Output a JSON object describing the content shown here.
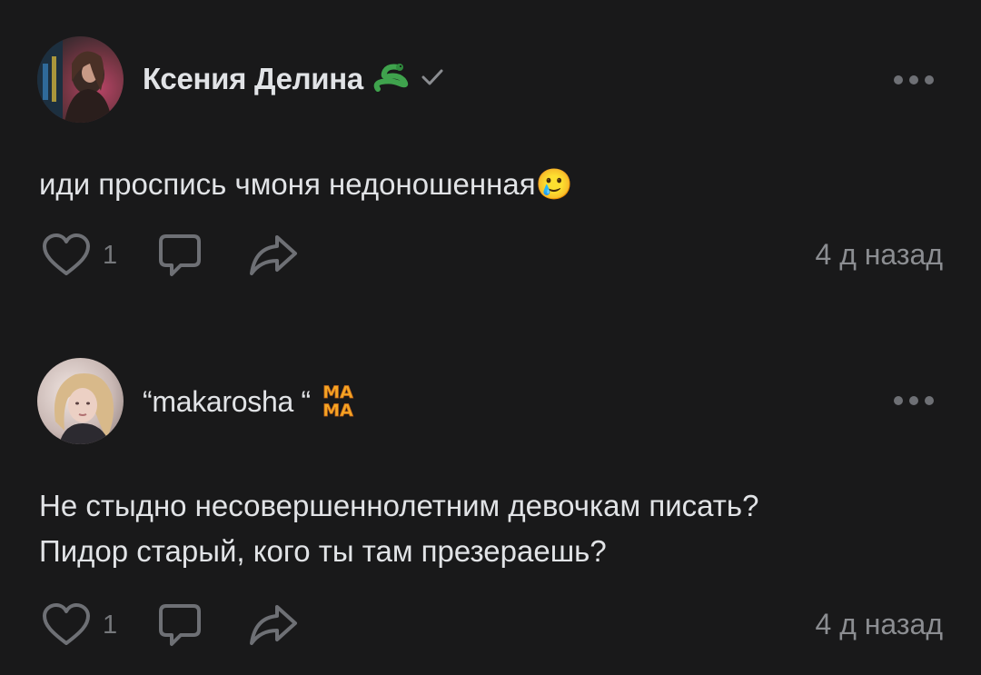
{
  "comments": [
    {
      "author": "Ксения Делина",
      "badge_icon": "snake-emoji-icon",
      "verified_icon": "check-icon",
      "text_lines": [
        "иди проспись чмоня недоношенная🥲"
      ],
      "likes": "1",
      "timestamp": "4 д назад"
    },
    {
      "author": "“makarosha “",
      "badge_icon": "mama-sticker-icon",
      "badge_text": [
        "МА",
        "МА"
      ],
      "text_lines": [
        "Не стыдно несовершеннолетним девочкам писать?",
        "Пидор старый, кого ты там презераешь?"
      ],
      "likes": "1",
      "timestamp": "4 д назад"
    }
  ],
  "colors": {
    "background": "#19191a",
    "text_primary": "#e1e3e6",
    "text_secondary": "#8b8d91",
    "icon": "#6e7075",
    "snake_badge": "#3fa34d",
    "mama_badge": "#f5a623"
  }
}
